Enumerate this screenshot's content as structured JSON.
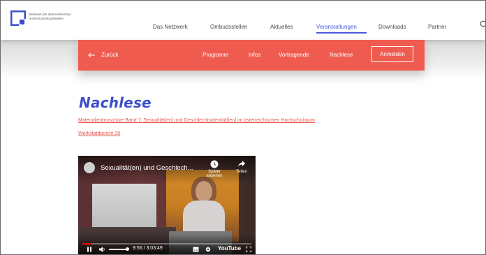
{
  "header": {
    "logo_text_line1": "Netzwerk der österreichischen",
    "logo_text_line2": "Hochschulombudsstellen",
    "nav": [
      "Das Netzwerk",
      "Ombudsstellen",
      "Aktuelles",
      "Veranstaltungen",
      "Downloads",
      "Partner"
    ],
    "active_nav": "Veranstaltungen",
    "search_icon": "search-icon"
  },
  "subnav": {
    "back_label": "Zurück",
    "items": [
      "Programm",
      "Infos",
      "Vortragende",
      "Nachlese"
    ],
    "cta_label": "Anmelden"
  },
  "main": {
    "title": "Nachlese",
    "links": [
      "Materialienbroschüre Band 7: Sexualität[en] und Geschlechtsidentität[en] im österreichischen Hochschulraum",
      "Werkstattbericht 28"
    ]
  },
  "video": {
    "title": "Sexualität(en) und Geschlech...",
    "watch_later": "Später ansehen",
    "share": "Teilen",
    "time": "9:56 / 3:03:49",
    "progress": 0.054,
    "brand": "YouTube"
  },
  "colors": {
    "accent": "#4a58d9",
    "subnav_bg": "#ef5b4f",
    "link": "#e4574c",
    "title": "#3d4fc9"
  }
}
